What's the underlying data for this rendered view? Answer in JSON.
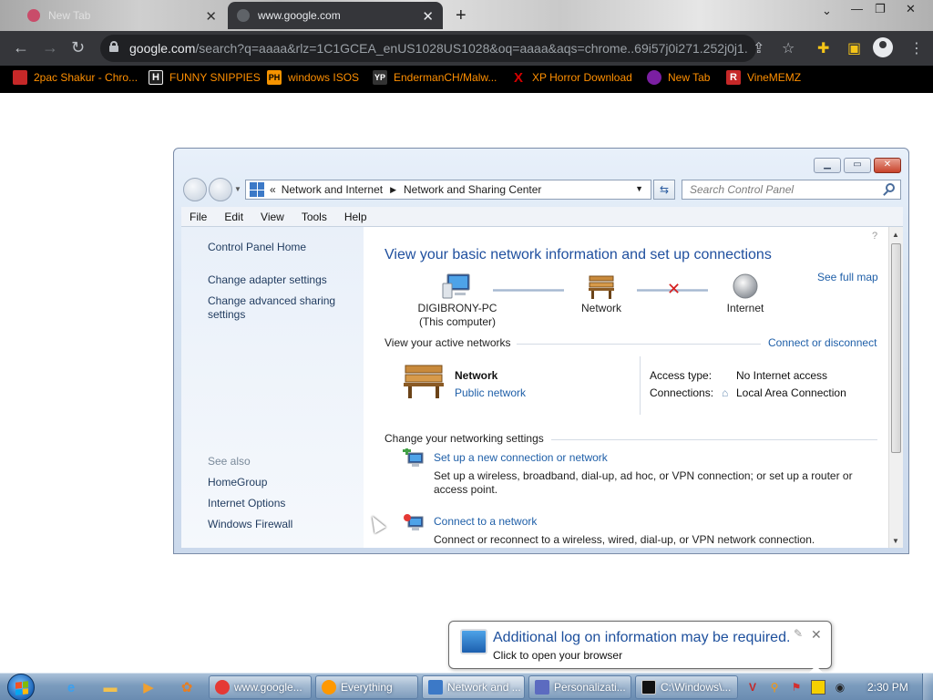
{
  "browser": {
    "tabs": [
      {
        "title": "New Tab",
        "active": false
      },
      {
        "title": "www.google.com",
        "active": true
      }
    ],
    "url_domain": "google.com",
    "url_rest": "/search?q=aaaa&rlz=1C1GCEA_enUS1028US1028&oq=aaaa&aqs=chrome..69i57j0i271.252j0j1...",
    "bookmarks": [
      {
        "label": "2pac Shakur - Chro...",
        "icon": "2pac-icon",
        "color": "#c62828"
      },
      {
        "label": "FUNNY SNIPPIES",
        "icon": "H",
        "color": "#222222"
      },
      {
        "label": "windows ISOS",
        "icon": "PH",
        "color": "#f59300"
      },
      {
        "label": "EndermanCH/Malw...",
        "icon": "YP",
        "color": "#333333"
      },
      {
        "label": "XP Horror Download",
        "icon": "X",
        "color": "#d50000"
      },
      {
        "label": "New Tab",
        "icon": "globe-icon",
        "color": "#7b1fa2"
      },
      {
        "label": "VineMEMZ",
        "icon": "R",
        "color": "#c62828"
      }
    ]
  },
  "control_panel": {
    "breadcrumb": {
      "separator": "«",
      "items": [
        "Network and Internet",
        "Network and Sharing Center"
      ]
    },
    "search_placeholder": "Search Control Panel",
    "menu": [
      "File",
      "Edit",
      "View",
      "Tools",
      "Help"
    ],
    "left_links": [
      "Control Panel Home",
      "Change adapter settings",
      "Change advanced sharing settings"
    ],
    "see_also_header": "See also",
    "see_also": [
      "HomeGroup",
      "Internet Options",
      "Windows Firewall"
    ],
    "heading": "View your basic network information and set up connections",
    "see_full_map": "See full map",
    "map": {
      "computer_name": "DIGIBRONY-PC",
      "computer_sub": "(This computer)",
      "network": "Network",
      "internet": "Internet"
    },
    "active_networks_header": "View your active networks",
    "connect_or_disconnect": "Connect or disconnect",
    "active_network": {
      "name": "Network",
      "type": "Public network",
      "access_type_label": "Access type:",
      "access_type_value": "No Internet access",
      "connections_label": "Connections:",
      "connections_value": "Local Area Connection"
    },
    "change_settings_header": "Change your networking settings",
    "tasks": [
      {
        "title": "Set up a new connection or network",
        "desc": "Set up a wireless, broadband, dial-up, ad hoc, or VPN connection; or set up a router or access point."
      },
      {
        "title": "Connect to a network",
        "desc": "Connect or reconnect to a wireless, wired, dial-up, or VPN network connection."
      }
    ]
  },
  "balloon": {
    "title": "Additional log on information may be required.",
    "subtitle": "Click to open your browser"
  },
  "taskbar": {
    "buttons": [
      {
        "label": "www.google...",
        "icon": "chrome-icon",
        "color": "#e53935"
      },
      {
        "label": "Everything",
        "icon": "everything-icon",
        "color": "#ff9800"
      },
      {
        "label": "Network and ...",
        "icon": "control-panel-icon",
        "color": "#3c79c7"
      },
      {
        "label": "Personalizati...",
        "icon": "personalization-icon",
        "color": "#5c6bc0"
      },
      {
        "label": "C:\\Windows\\...",
        "icon": "cmd-icon",
        "color": "#111111"
      }
    ],
    "clock": "2:30 PM"
  }
}
